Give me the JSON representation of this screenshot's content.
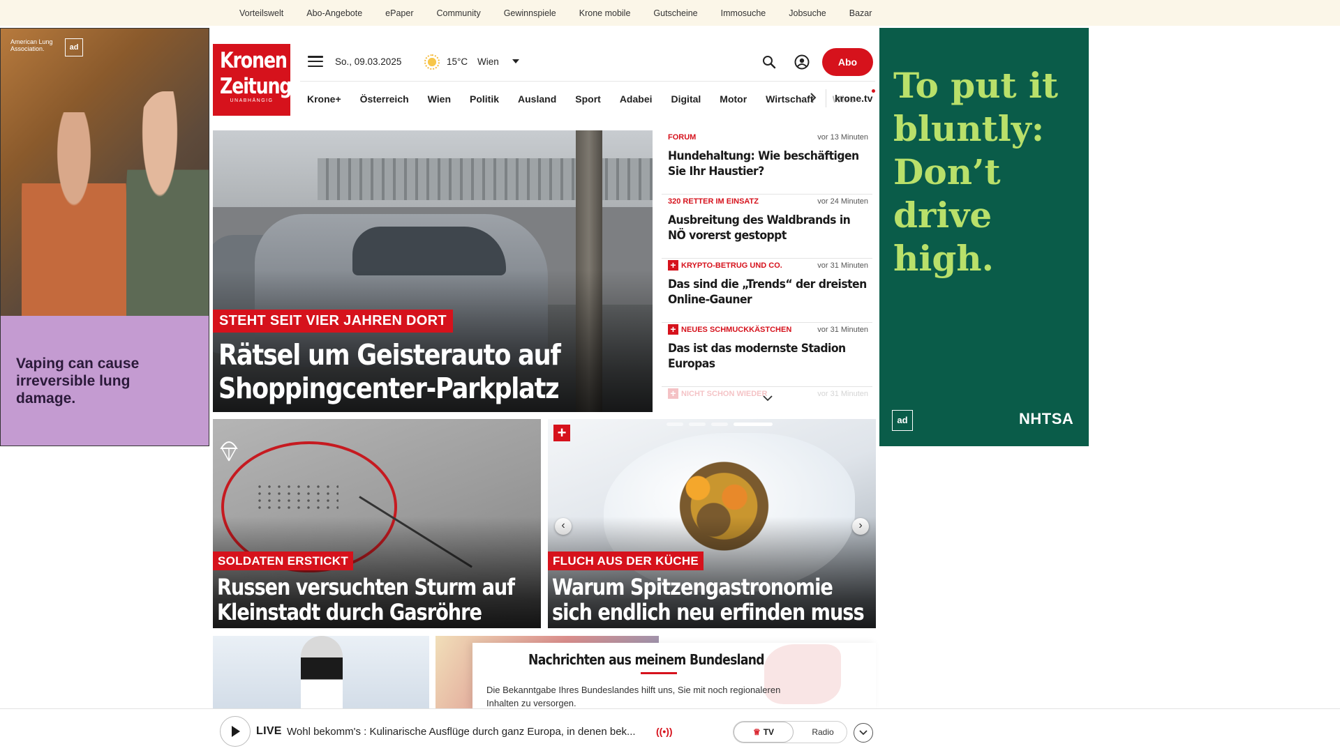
{
  "topbar": {
    "links": [
      "Vorteilswelt",
      "Abo-Angebote",
      "ePaper",
      "Community",
      "Gewinnspiele",
      "Krone mobile",
      "Gutscheine",
      "Immosuche",
      "Jobsuche",
      "Bazar"
    ]
  },
  "ads": {
    "left": {
      "org": "American Lung Association.",
      "adcouncil": "ad",
      "message": "Vaping can cause irreversible lung damage.",
      "color_panel": "#c49bd1"
    },
    "right": {
      "message": "To put it bluntly: Don’t drive high.",
      "adcouncil": "ad",
      "sponsor": "NHTSA",
      "bg_color": "#0a5c49",
      "text_color": "#b9e06a"
    }
  },
  "header": {
    "logo_line1": "Kronen",
    "logo_line2": "Zeitung",
    "logo_tagline": "UNABHÄNGIG",
    "date": "So., 09.03.2025",
    "weather_icon": "sun-icon",
    "temperature": "15°C",
    "city": "Wien",
    "abo_label": "Abo",
    "accent_color": "#d6121c"
  },
  "nav": {
    "items": [
      "Krone+",
      "Österreich",
      "Wien",
      "Politik",
      "Ausland",
      "Sport",
      "Adabei",
      "Digital",
      "Motor",
      "Wirtschaft"
    ],
    "truncated": "Wiss",
    "tv_label": "krone.tv"
  },
  "hero": {
    "kicker": "Steht seit vier Jahren dort",
    "headline": "Rätsel um Geisterauto auf Shoppingcenter-Parkplatz"
  },
  "ticker": [
    {
      "category": "Forum",
      "time": "vor 13 Minuten",
      "title": "Hundehaltung: Wie beschäftigen Sie Ihr Haustier?",
      "plus": false
    },
    {
      "category": "320 Retter im Einsatz",
      "time": "vor 24 Minuten",
      "title": "Ausbreitung des Waldbrands in NÖ vorerst gestoppt",
      "plus": false
    },
    {
      "category": "Krypto-Betrug und Co.",
      "time": "vor 31 Minuten",
      "title": "Das sind die „Trends“ der dreisten Online-Gauner",
      "plus": true
    },
    {
      "category": "Neues Schmuckkästchen",
      "time": "vor 31 Minuten",
      "title": "Das ist das modernste Stadion Europas",
      "plus": true
    },
    {
      "category": "Nicht schon wieder",
      "time": "vor 31 Minuten",
      "title": "",
      "plus": true
    }
  ],
  "cards": [
    {
      "kicker": "Soldaten erstickt",
      "headline": "Russen versuchten Sturm auf Kleinstadt durch Gasröhre"
    },
    {
      "kicker": "Fluch aus der Küche",
      "headline": "Warum Spitzengastronomie sich endlich neu erfinden muss"
    }
  ],
  "bundesland": {
    "title": "Nachrichten aus meinem Bundesland",
    "text": "Die Bekanntgabe Ihres Bundeslandes hilft uns, Sie mit noch regionaleren Inhalten zu versorgen."
  },
  "player": {
    "live_label": "LIVE",
    "now_playing": "Wohl bekomm's : Kulinarische Ausflüge durch ganz Europa, in denen bek...",
    "tv_label": "TV",
    "radio_label": "Radio"
  }
}
